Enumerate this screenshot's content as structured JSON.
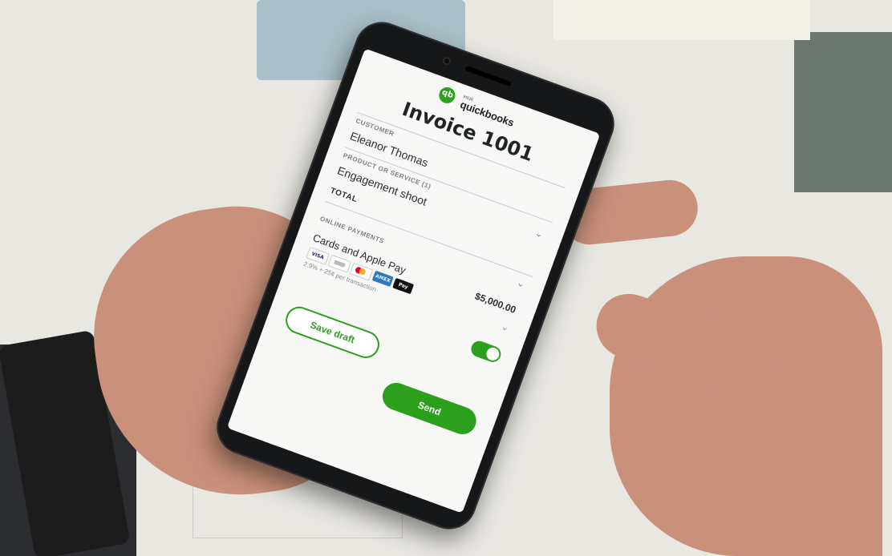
{
  "app": {
    "brand_sub": "intuit",
    "brand_name": "quickbooks",
    "title": "Invoice 1001"
  },
  "fields": {
    "customer_label": "CUSTOMER",
    "customer_value": "Eleanor Thomas",
    "product_label": "PRODUCT OR SERVICE (1)",
    "product_value": "Engagement shoot",
    "total_label": "TOTAL",
    "total_value": "$5,000.00",
    "online_payments_label": "ONLINE PAYMENTS",
    "payment_method": "Cards and Apple Pay",
    "fee_text": "2.9% + 25¢ per transaction"
  },
  "cards": {
    "visa": "VISA",
    "amex": "AMEX",
    "apple_pay": "Pay"
  },
  "toggle": {
    "online_payments_enabled": true
  },
  "buttons": {
    "save_draft": "Save draft",
    "send": "Send"
  },
  "colors": {
    "accent": "#2ca01c",
    "phone_body": "#161718",
    "screen_bg": "#f7f7f6"
  }
}
